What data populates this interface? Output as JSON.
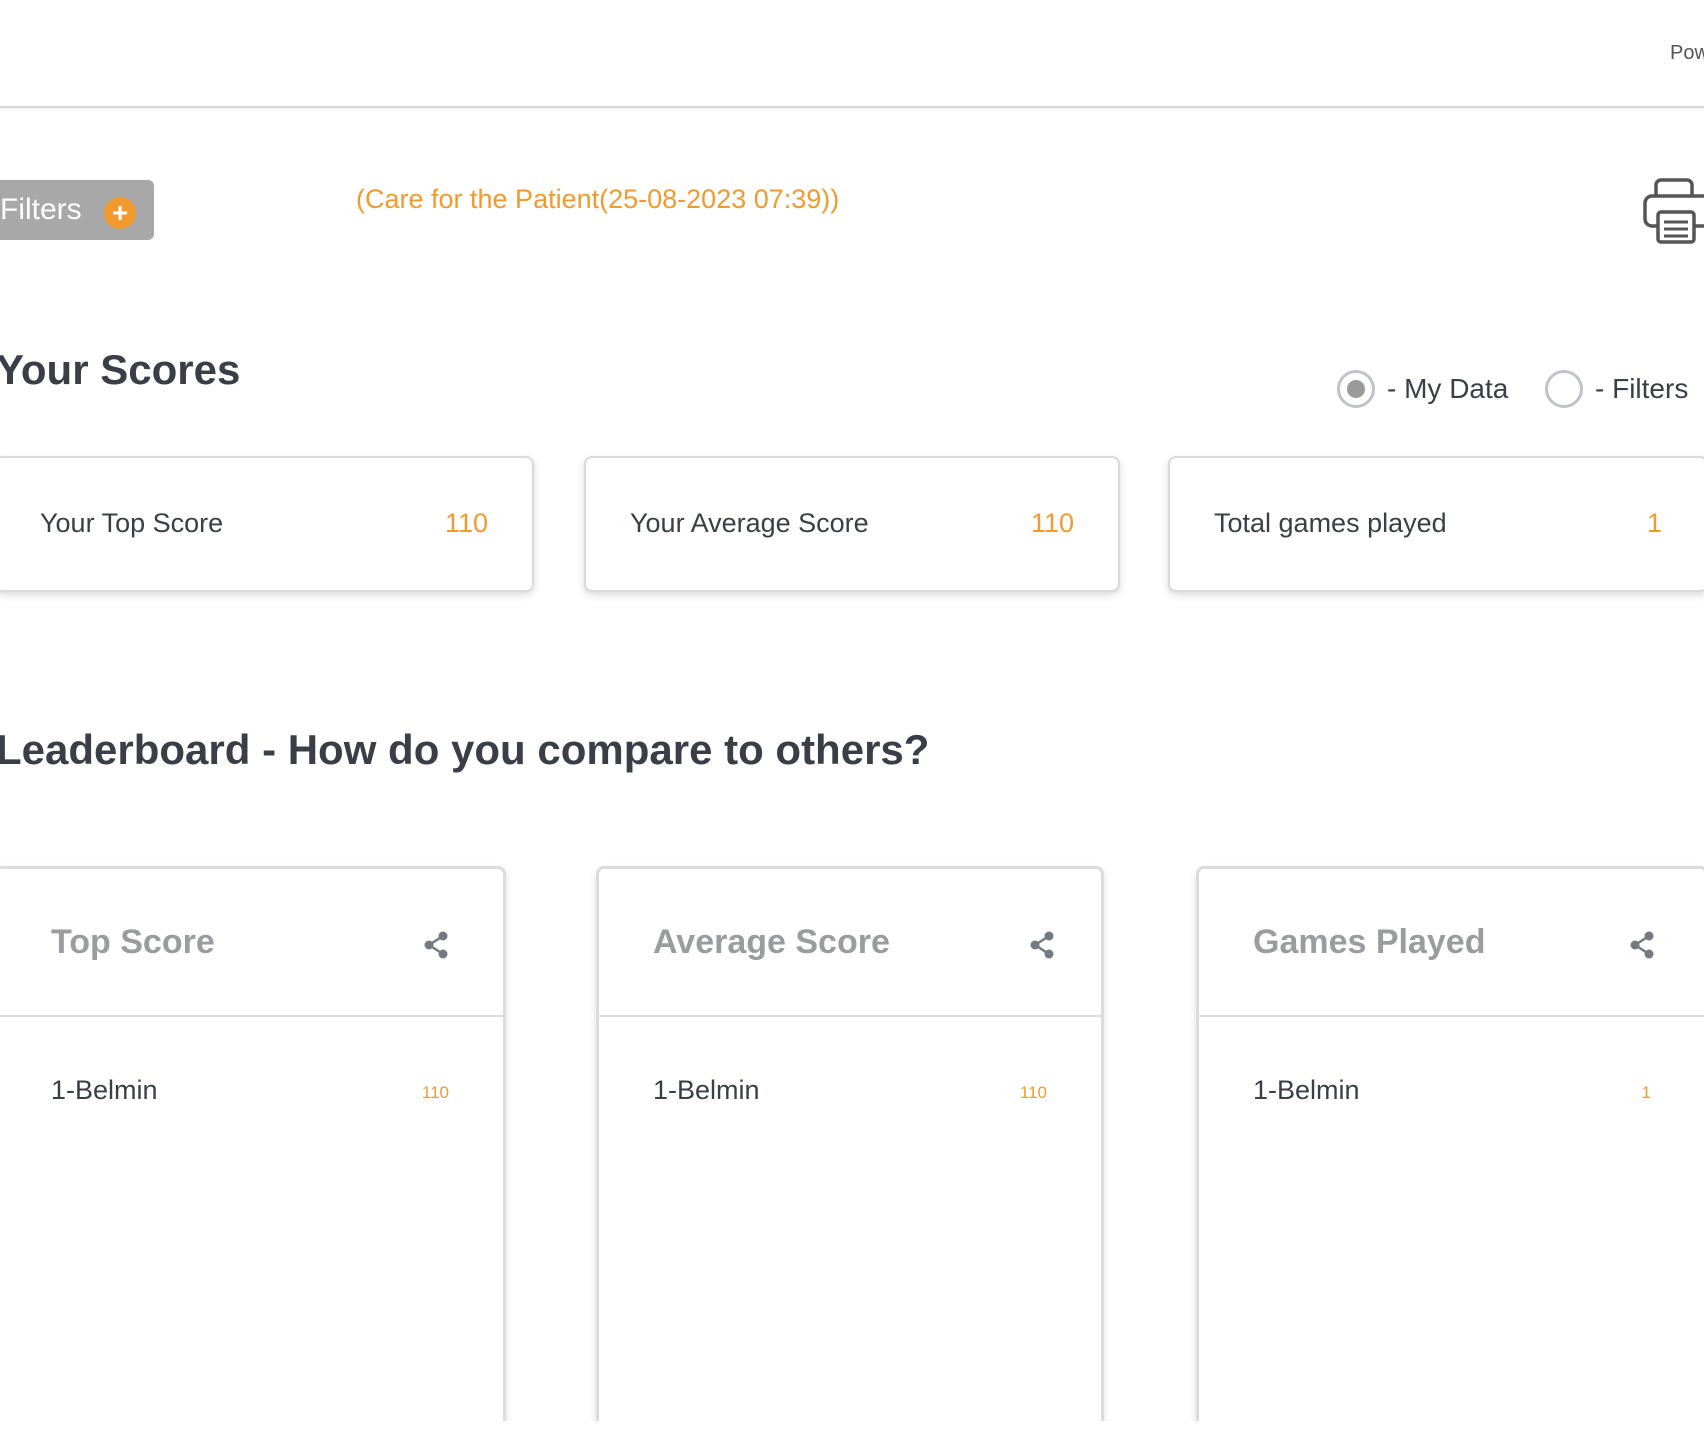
{
  "header": {
    "powered_text": "Pow"
  },
  "toolbar": {
    "filters_label": "Filters",
    "plus_symbol": "+",
    "context_title": "(Care for the Patient(25-08-2023 07:39))",
    "print_icon": "printer-icon"
  },
  "your_scores": {
    "title": "Your Scores",
    "radio_options": [
      {
        "label": "- My Data",
        "checked": true
      },
      {
        "label": "- Filters",
        "checked": false
      }
    ],
    "cards": [
      {
        "label": "Your Top Score",
        "value": "110"
      },
      {
        "label": "Your Average Score",
        "value": "110"
      },
      {
        "label": "Total games played",
        "value": "1"
      }
    ]
  },
  "leaderboard": {
    "title": "Leaderboard - How do you compare to others?",
    "share_icon": "share-icon",
    "cards": [
      {
        "title": "Top Score",
        "rows": [
          {
            "name": "1-Belmin",
            "value": "110"
          }
        ]
      },
      {
        "title": "Average Score",
        "rows": [
          {
            "name": "1-Belmin",
            "value": "110"
          }
        ]
      },
      {
        "title": "Games Played",
        "rows": [
          {
            "name": "1-Belmin",
            "value": "1"
          }
        ]
      }
    ]
  },
  "colors": {
    "accent": "#f29a2e",
    "text": "#3a3f47",
    "muted": "#9a9ca0",
    "filters_bg": "#a8a8a8"
  }
}
